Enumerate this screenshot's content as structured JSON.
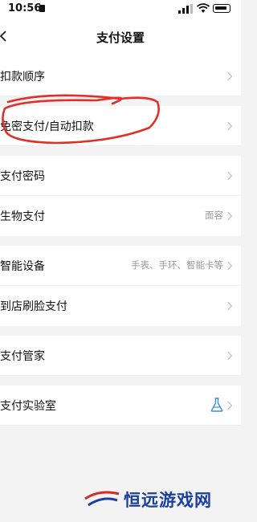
{
  "status_bar": {
    "time": "10:56"
  },
  "nav": {
    "title": "支付设置"
  },
  "menu": {
    "groups": [
      {
        "items": [
          {
            "label": "扣款顺序",
            "value": ""
          }
        ]
      },
      {
        "items": [
          {
            "label": "免密支付/自动扣款",
            "value": ""
          }
        ]
      },
      {
        "items": [
          {
            "label": "支付密码",
            "value": ""
          },
          {
            "label": "生物支付",
            "value": "面容"
          }
        ]
      },
      {
        "items": [
          {
            "label": "智能设备",
            "value": "手表、手环、智能卡等"
          },
          {
            "label": "到店刷脸支付",
            "value": ""
          }
        ]
      },
      {
        "items": [
          {
            "label": "支付管家",
            "value": ""
          }
        ]
      },
      {
        "items": [
          {
            "label": "支付实验室",
            "value": "",
            "icon": "flask-icon"
          }
        ]
      }
    ]
  },
  "annotation": {
    "color": "#e0302a"
  },
  "watermark": {
    "text": "恒远游戏网"
  },
  "colors": {
    "accent_blue": "#3a8fe0",
    "chevron": "#c4c4c4"
  }
}
